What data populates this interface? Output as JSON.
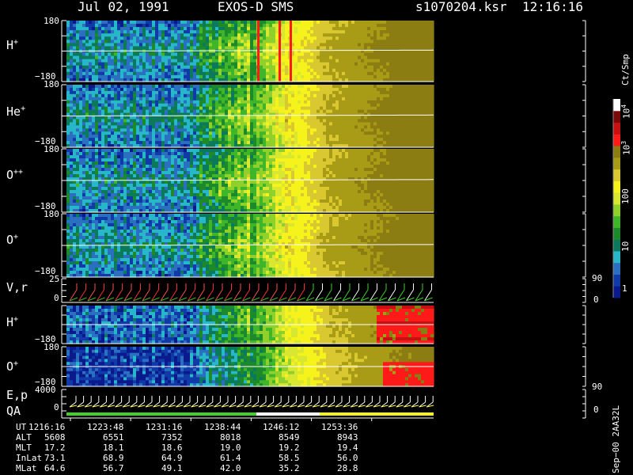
{
  "header": {
    "date": "Jul 02, 1991",
    "instrument": "EXOS-D SMS",
    "file": "s1070204.ksr",
    "time": "12:16:16"
  },
  "colors": {
    "background": "#000000",
    "text": "#ffffff",
    "colormap": [
      "#0a1a8c",
      "#0f3aa8",
      "#2a6fc0",
      "#27b7c8",
      "#0b7a5c",
      "#1c8a2a",
      "#3fb52a",
      "#8fd12a",
      "#d8e830",
      "#f5f21c",
      "#d9c830",
      "#a89b16",
      "#8b7d12",
      "#ff1a1a",
      "#c81010",
      "#7a0a0a",
      "#ffffff"
    ]
  },
  "chart_data": {
    "type": "heatmap",
    "description_units": "time series spectrogram panels",
    "time_axis": {
      "tick_labels": [
        "1216:16",
        "1223:48",
        "1231:16",
        "1238:44",
        "1246:12",
        "1253:36"
      ]
    },
    "panels": [
      {
        "id": "h_plus_angle",
        "species": "H",
        "charge": "+",
        "yrange": [
          -180,
          180
        ],
        "tick_top": "180",
        "tick_bottom": "−180"
      },
      {
        "id": "he_plus_angle",
        "species": "He",
        "charge": "+",
        "yrange": [
          -180,
          180
        ],
        "tick_top": "180",
        "tick_bottom": "−180"
      },
      {
        "id": "o_plusplus_angle",
        "species": "O",
        "charge": "++",
        "yrange": [
          -180,
          180
        ],
        "tick_top": "180",
        "tick_bottom": "−180"
      },
      {
        "id": "o_plus_angle",
        "species": "O",
        "charge": "+",
        "yrange": [
          -180,
          180
        ],
        "tick_top": "180",
        "tick_bottom": "−180"
      },
      {
        "id": "vr",
        "label": "V,r",
        "ytick_top": "25",
        "ytick_zero": "0",
        "right_tick_top": "90",
        "right_tick_zero": "0"
      },
      {
        "id": "h_plus_2",
        "species": "H",
        "charge": "+",
        "yrange": [
          -180,
          180
        ],
        "tick_bottom": "−180"
      },
      {
        "id": "o_plus_2",
        "species": "O",
        "charge": "+",
        "yrange": [
          -180,
          180
        ],
        "tick_top": "180",
        "tick_bottom": "−180"
      },
      {
        "id": "ep_qa",
        "label_top": "E,p",
        "label_bottom": "QA",
        "ytick_top": "4000",
        "ytick_zero": "0",
        "right_tick_top": "90",
        "right_tick_zero": "0"
      }
    ],
    "colorbar": {
      "label": "Ct/Smp",
      "ticks": [
        {
          "label": "1",
          "value": 1
        },
        {
          "label": "10",
          "value": 10
        },
        {
          "label": "100",
          "value": 100
        },
        {
          "label": "10",
          "exp": "3",
          "value": 1000
        },
        {
          "label": "10",
          "exp": "4",
          "value": 10000
        }
      ],
      "scale": "log"
    },
    "ephemeris": {
      "rows": [
        {
          "label": "UT",
          "values": [
            "1216:16",
            "1223:48",
            "1231:16",
            "1238:44",
            "1246:12",
            "1253:36"
          ]
        },
        {
          "label": "ALT",
          "values": [
            "5608",
            "6551",
            "7352",
            "8018",
            "8549",
            "8943"
          ]
        },
        {
          "label": "MLT",
          "values": [
            "17.2",
            "18.1",
            "18.6",
            "19.0",
            "19.2",
            "19.4"
          ]
        },
        {
          "label": "InLat",
          "values": [
            "73.1",
            "68.9",
            "64.9",
            "61.4",
            "58.5",
            "56.0"
          ]
        },
        {
          "label": "MLat",
          "values": [
            "64.6",
            "56.7",
            "49.1",
            "42.0",
            "35.2",
            "28.8"
          ]
        }
      ]
    },
    "footer_note": "Sep−00  2AA32L"
  }
}
